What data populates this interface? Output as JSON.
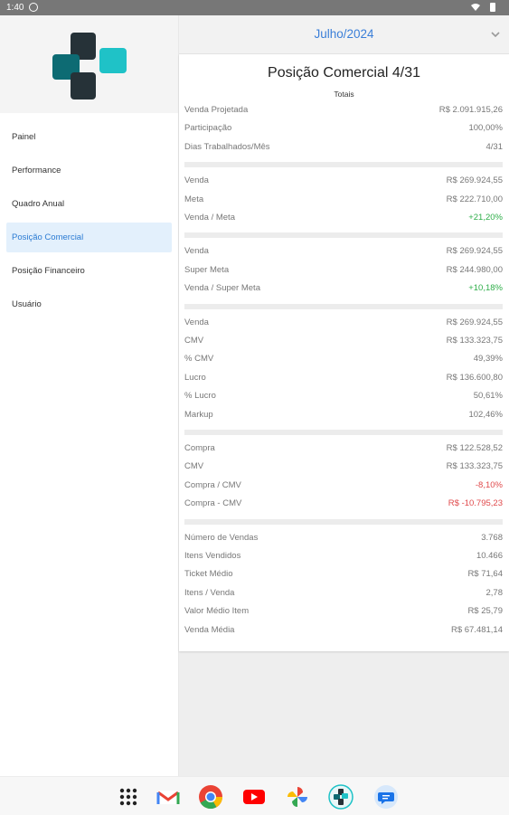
{
  "status_bar": {
    "time": "1:40"
  },
  "sidebar": {
    "logo_icon": "app-logo-blocks",
    "items": [
      {
        "label": "Painel",
        "active": false
      },
      {
        "label": "Performance",
        "active": false
      },
      {
        "label": "Quadro Anual",
        "active": false
      },
      {
        "label": "Posição Comercial",
        "active": true
      },
      {
        "label": "Posição Financeiro",
        "active": false
      },
      {
        "label": "Usuário",
        "active": false
      }
    ]
  },
  "header": {
    "month": "Julho/2024",
    "chevron_icon": "chevron-down-icon"
  },
  "report": {
    "title": "Posição Comercial 4/31",
    "subtitle": "Totais",
    "groups": [
      [
        {
          "label": "Venda Projetada",
          "value": "R$ 2.091.915,26"
        },
        {
          "label": "Participação",
          "value": "100,00%"
        },
        {
          "label": "Dias Trabalhados/Mês",
          "value": "4/31"
        }
      ],
      [
        {
          "label": "Venda",
          "value": "R$ 269.924,55"
        },
        {
          "label": "Meta",
          "value": "R$ 222.710,00"
        },
        {
          "label": "Venda / Meta",
          "value": "+21,20%",
          "tone": "pos"
        }
      ],
      [
        {
          "label": "Venda",
          "value": "R$ 269.924,55"
        },
        {
          "label": "Super Meta",
          "value": "R$ 244.980,00"
        },
        {
          "label": "Venda / Super Meta",
          "value": "+10,18%",
          "tone": "pos"
        }
      ],
      [
        {
          "label": "Venda",
          "value": "R$ 269.924,55"
        },
        {
          "label": "CMV",
          "value": "R$ 133.323,75"
        },
        {
          "label": "% CMV",
          "value": "49,39%"
        },
        {
          "label": "Lucro",
          "value": "R$ 136.600,80"
        },
        {
          "label": "% Lucro",
          "value": "50,61%"
        },
        {
          "label": "Markup",
          "value": "102,46%"
        }
      ],
      [
        {
          "label": "Compra",
          "value": "R$ 122.528,52"
        },
        {
          "label": "CMV",
          "value": "R$ 133.323,75"
        },
        {
          "label": "Compra / CMV",
          "value": "-8,10%",
          "tone": "neg"
        },
        {
          "label": "Compra - CMV",
          "value": "R$ -10.795,23",
          "tone": "neg"
        }
      ],
      [
        {
          "label": "Número de Vendas",
          "value": "3.768"
        },
        {
          "label": "Itens Vendidos",
          "value": "10.466"
        },
        {
          "label": "Ticket Médio",
          "value": "R$ 71,64"
        },
        {
          "label": "Itens / Venda",
          "value": "2,78"
        },
        {
          "label": "Valor Médio Item",
          "value": "R$ 25,79"
        },
        {
          "label": "Venda Média",
          "value": "R$ 67.481,14"
        }
      ]
    ]
  },
  "dock": [
    {
      "name": "app-drawer-icon"
    },
    {
      "name": "gmail-icon"
    },
    {
      "name": "chrome-icon"
    },
    {
      "name": "youtube-icon"
    },
    {
      "name": "photos-icon"
    },
    {
      "name": "app-logo-icon"
    },
    {
      "name": "messages-icon"
    }
  ],
  "colors": {
    "accent": "#3b7fd8",
    "positive": "#2fae4a",
    "negative": "#e0494b",
    "logo_dark": "#263238",
    "logo_teal_dark": "#0d6b73",
    "logo_teal_light": "#1fc2c7"
  }
}
